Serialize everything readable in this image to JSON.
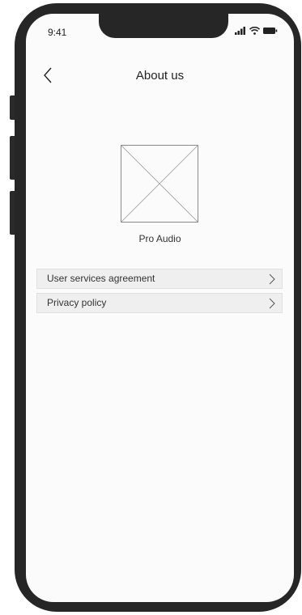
{
  "status_bar": {
    "time": "9:41",
    "icons": [
      "signal-icon",
      "wifi-icon",
      "battery-icon"
    ]
  },
  "header": {
    "title": "About us",
    "back_icon": "chevron-left-icon"
  },
  "app_info": {
    "logo_icon": "image-placeholder-icon",
    "name": "Pro Audio"
  },
  "menu": {
    "items": [
      {
        "label": "User services agreement",
        "icon": "chevron-right-icon"
      },
      {
        "label": "Privacy policy",
        "icon": "chevron-right-icon"
      }
    ]
  },
  "colors": {
    "frame": "#262626",
    "screen": "#fbfbfb",
    "row_bg": "#efefef",
    "text": "#222222"
  }
}
